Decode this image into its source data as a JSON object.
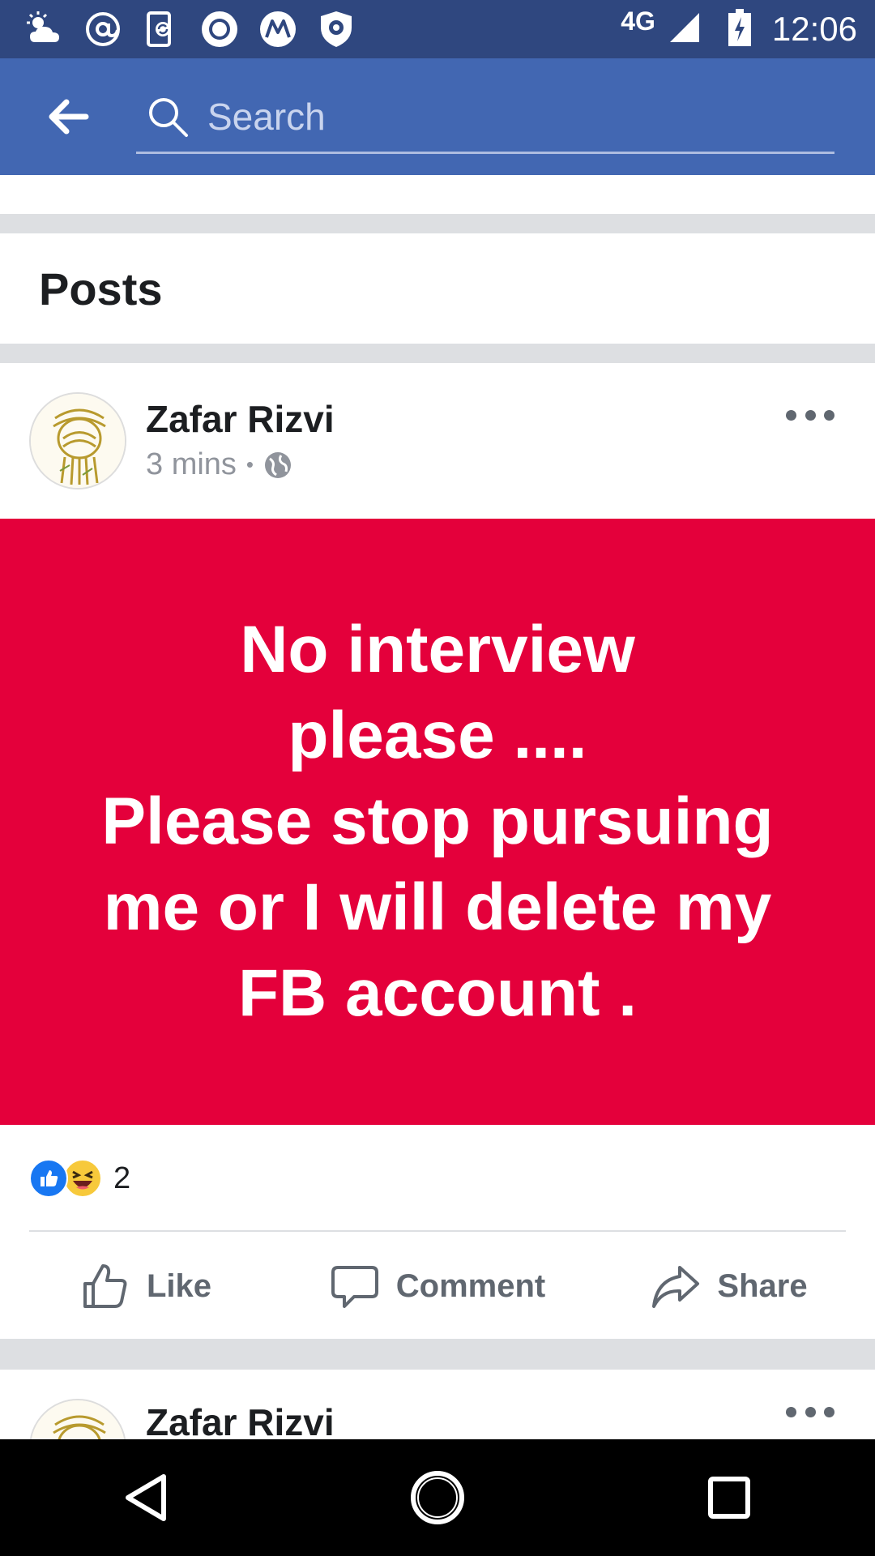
{
  "status_bar": {
    "network": "4G",
    "time": "12:06",
    "icons": [
      "weather-icon",
      "at-icon",
      "phone-sync-icon",
      "circle-app-icon",
      "motorola-icon",
      "shield-app-icon",
      "signal-icon",
      "battery-charging-icon"
    ]
  },
  "app_bar": {
    "search_placeholder": "Search"
  },
  "posts_section": {
    "heading": "Posts"
  },
  "post": {
    "author": "Zafar Rizvi",
    "time": "3 mins",
    "separator": "•",
    "privacy_icon": "globe-icon",
    "text": "No interview\nplease ....\nPlease stop pursuing\nme or I will delete my\nFB account .",
    "background_color": "#e4003b",
    "reaction_count": "2",
    "actions": {
      "like": "Like",
      "comment": "Comment",
      "share": "Share"
    }
  },
  "next_post": {
    "author": "Zafar Rizvi"
  },
  "colors": {
    "status_bar": "#2f477f",
    "app_bar": "#4267b2",
    "post_background": "#e4003b"
  }
}
